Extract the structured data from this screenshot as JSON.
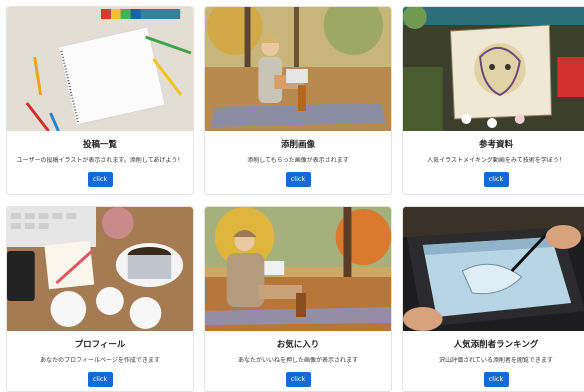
{
  "cards": [
    {
      "title": "投稿一覧",
      "description": "ユーザーの投稿イラストが表示されます。添削してあげよう！",
      "button": "click",
      "image": "sketchbook-with-colored-pencils"
    },
    {
      "title": "添削画像",
      "description": "添削してもらった画像が表示されます",
      "button": "click",
      "image": "woman-with-laptop-on-autumn-picnic"
    },
    {
      "title": "参考資料",
      "description": "人気イラストメイキング動画をみて技術を学ぼう！",
      "button": "click",
      "image": "painting-and-art-supplies"
    },
    {
      "title": "プロフィール",
      "description": "あなたのプロフィールページを作成できます",
      "button": "click",
      "image": "coffee-and-doilies-desk"
    },
    {
      "title": "お気に入り",
      "description": "あなたがいいねを押した画像が表示されます",
      "button": "click",
      "image": "woman-writing-in-autumn-park"
    },
    {
      "title": "人気添削者ランキング",
      "description": "沢山評価されている添削者を閲覧できます",
      "button": "click",
      "image": "drawing-on-pen-tablet"
    }
  ]
}
